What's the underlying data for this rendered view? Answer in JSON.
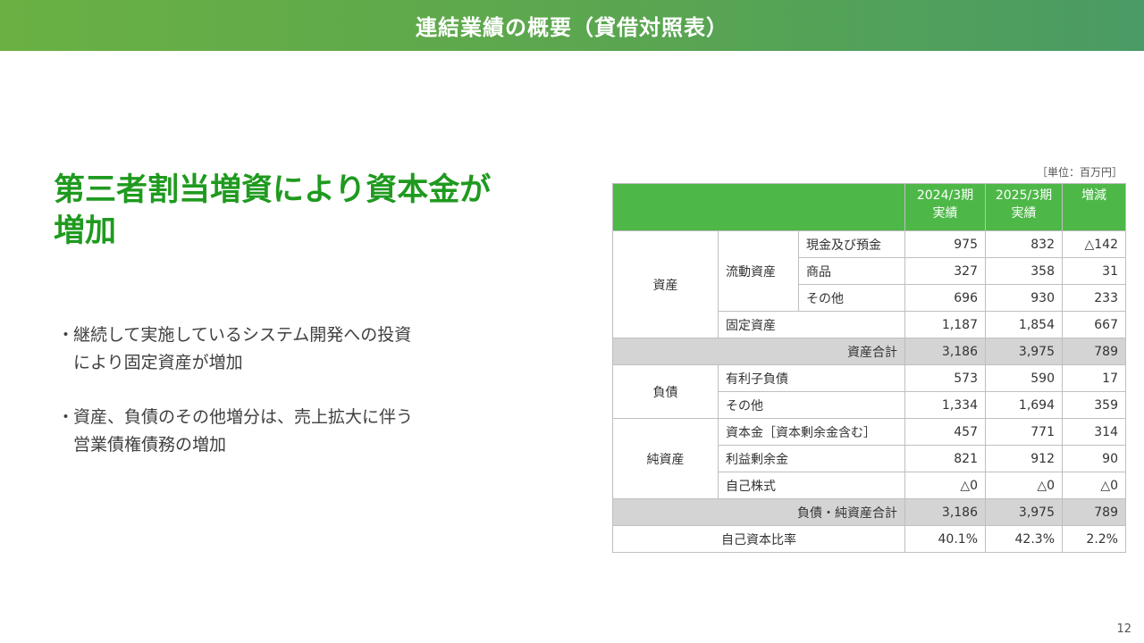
{
  "header": {
    "title": "連結業績の概要（貸借対照表）"
  },
  "headline": [
    "第三者割当増資により資本金が",
    "増加"
  ],
  "bullets": [
    {
      "mark": "・",
      "lines": [
        "継続して実施しているシステム開発への投資",
        "により固定資産が増加"
      ]
    },
    {
      "mark": "・",
      "lines": [
        "資産、負債のその他増分は、売上拡大に伴う",
        "営業債権債務の増加"
      ]
    }
  ],
  "table": {
    "unit": "［単位：百万円］",
    "columns": [
      {
        "lines": [
          "2024/3期",
          "実績"
        ]
      },
      {
        "lines": [
          "2025/3期",
          "実績"
        ]
      },
      {
        "lines": [
          "増減"
        ]
      }
    ],
    "sections": {
      "assets": "資産",
      "current_assets": "流動資産",
      "liabilities": "負債",
      "net_assets": "純資産"
    },
    "rows": {
      "cash": {
        "label": "現金及び預金",
        "v2024": "975",
        "v2025": "832",
        "diff": "△142"
      },
      "goods": {
        "label": "商品",
        "v2024": "327",
        "v2025": "358",
        "diff": "31"
      },
      "other_current": {
        "label": "その他",
        "v2024": "696",
        "v2025": "930",
        "diff": "233"
      },
      "fixed": {
        "label": "固定資産",
        "v2024": "1,187",
        "v2025": "1,854",
        "diff": "667"
      },
      "total_assets": {
        "label": "資産合計",
        "v2024": "3,186",
        "v2025": "3,975",
        "diff": "789"
      },
      "debt": {
        "label": "有利子負債",
        "v2024": "573",
        "v2025": "590",
        "diff": "17"
      },
      "other_liab": {
        "label": "その他",
        "v2024": "1,334",
        "v2025": "1,694",
        "diff": "359"
      },
      "capital": {
        "label": "資本金［資本剰余金含む］",
        "v2024": "457",
        "v2025": "771",
        "diff": "314"
      },
      "retained": {
        "label": "利益剰余金",
        "v2024": "821",
        "v2025": "912",
        "diff": "90"
      },
      "treasury": {
        "label": "自己株式",
        "v2024": "△0",
        "v2025": "△0",
        "diff": "△0"
      },
      "total_liab_net": {
        "label": "負債・純資産合計",
        "v2024": "3,186",
        "v2025": "3,975",
        "diff": "789"
      },
      "equity_ratio": {
        "label": "自己資本比率",
        "v2024": "40.1%",
        "v2025": "42.3%",
        "diff": "2.2%"
      }
    }
  },
  "page_number": "12"
}
